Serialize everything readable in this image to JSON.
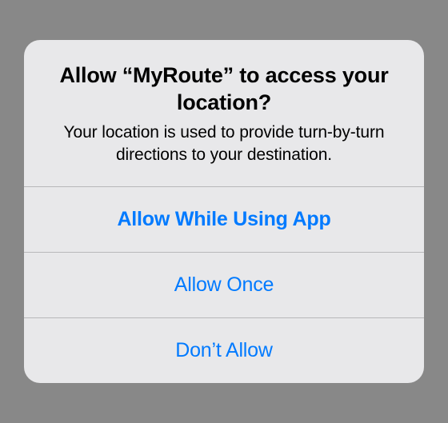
{
  "alert": {
    "title": "Allow “MyRoute” to access your location?",
    "message": "Your location is used to provide turn-by-turn directions to your destination.",
    "buttons": {
      "allow_while_using": "Allow While Using App",
      "allow_once": "Allow Once",
      "dont_allow": "Don’t Allow"
    }
  }
}
